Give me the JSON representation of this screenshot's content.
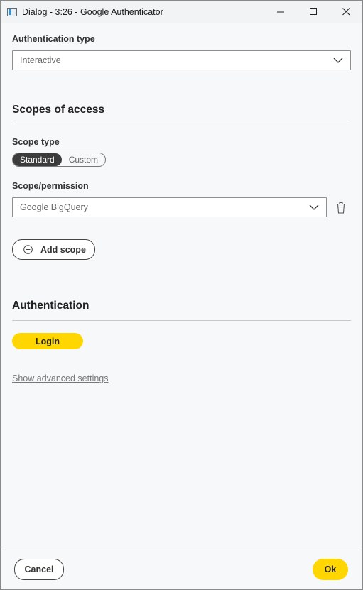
{
  "window": {
    "title": "Dialog - 3:26 - Google Authenticator"
  },
  "auth_type": {
    "label": "Authentication type",
    "value": "Interactive"
  },
  "scopes": {
    "title": "Scopes of access",
    "scope_type_label": "Scope type",
    "options": [
      "Standard",
      "Custom"
    ],
    "selected": "Standard",
    "permission_label": "Scope/permission",
    "permission_value": "Google BigQuery",
    "add_scope_label": "Add scope"
  },
  "authentication": {
    "title": "Authentication",
    "login_label": "Login"
  },
  "advanced_link": "Show advanced settings",
  "footer": {
    "cancel_label": "Cancel",
    "ok_label": "Ok"
  },
  "colors": {
    "accent": "#ffd600",
    "toggle_active": "#3c3c3c"
  }
}
